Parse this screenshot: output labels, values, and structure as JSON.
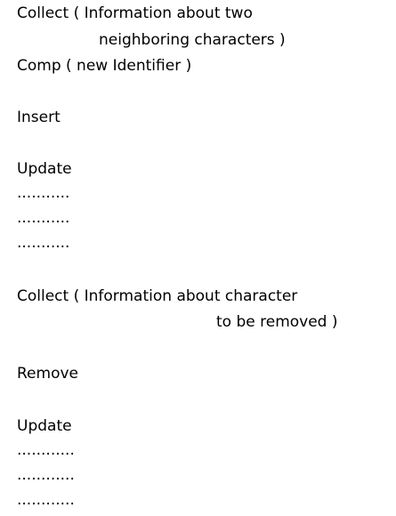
{
  "block1": {
    "collect_line1": "Collect ( Information about two",
    "collect_line2": "neighboring characters )",
    "comp": "Comp ( new Identifier )",
    "insert": "Insert",
    "update": "Update",
    "dots": [
      "...........",
      "...........",
      "..........."
    ]
  },
  "block2": {
    "collect_line1": "Collect ( Information about character",
    "collect_line2": "to be removed )",
    "remove": "Remove",
    "update": "Update",
    "dots": [
      "............",
      "............",
      "............"
    ]
  }
}
